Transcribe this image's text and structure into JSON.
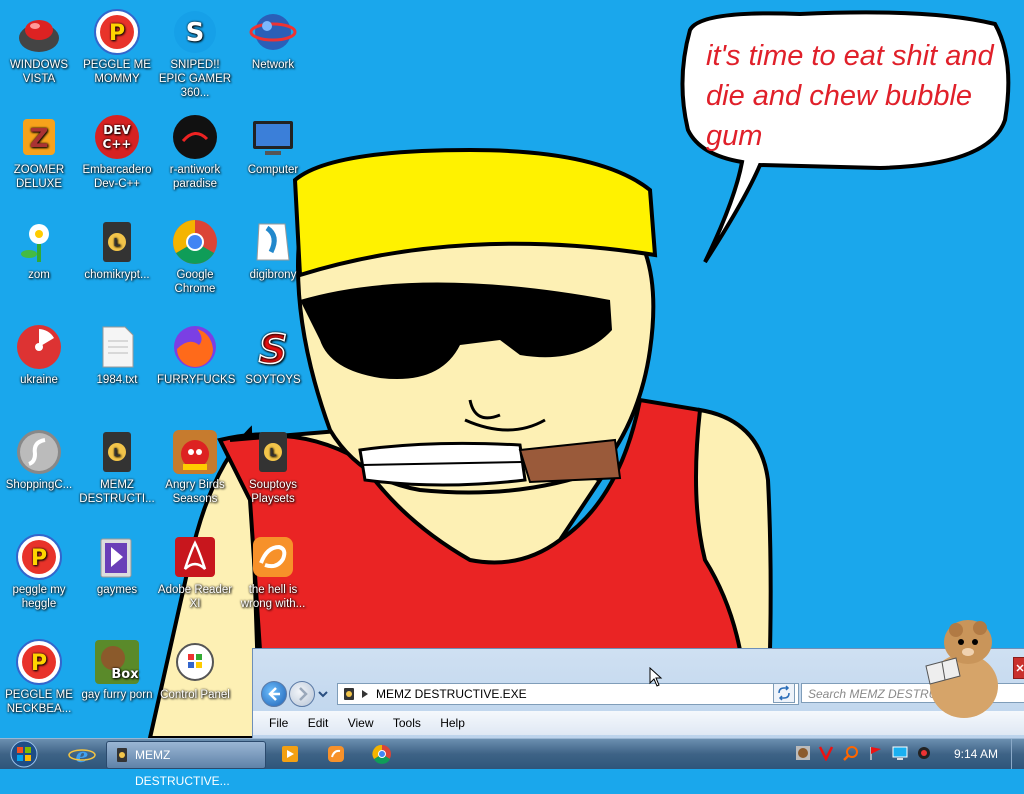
{
  "desktop": {
    "icons": [
      {
        "label": "WINDOWS VISTA"
      },
      {
        "label": "PEGGLE ME MOMMY"
      },
      {
        "label": "SNIPED!! EPIC GAMER 360..."
      },
      {
        "label": "Network"
      },
      {
        "label": "ZOOMER DELUXE"
      },
      {
        "label": "Embarcadero Dev-C++"
      },
      {
        "label": "r-antiwork paradise"
      },
      {
        "label": "Computer"
      },
      {
        "label": "zom"
      },
      {
        "label": "chomikrypt..."
      },
      {
        "label": "Google Chrome"
      },
      {
        "label": "digibrony"
      },
      {
        "label": "ukraine"
      },
      {
        "label": "1984.txt"
      },
      {
        "label": "FURRYFUCKS"
      },
      {
        "label": "SOYTOYS"
      },
      {
        "label": "ShoppingC..."
      },
      {
        "label": "MEMZ DESTRUCTI..."
      },
      {
        "label": "Angry Birds Seasons"
      },
      {
        "label": "Souptoys Playsets"
      },
      {
        "label": "peggle my heggle"
      },
      {
        "label": "gaymes"
      },
      {
        "label": "Adobe Reader XI"
      },
      {
        "label": "the hell is wrong with..."
      },
      {
        "label": "PEGGLE ME NECKBEA..."
      },
      {
        "label": "gay furry porn"
      },
      {
        "label": "Control Panel"
      }
    ],
    "speech_bubble": "it's time to eat shit and die and chew bubble gum"
  },
  "explorer": {
    "address": "MEMZ DESTRUCTIVE.EXE",
    "search_placeholder": "Search MEMZ DESTRUCTI...",
    "menu": [
      "File",
      "Edit",
      "View",
      "Tools",
      "Help"
    ]
  },
  "taskbar": {
    "active_window": "MEMZ DESTRUCTIVE...",
    "clock": "9:14 AM"
  },
  "colors": {
    "desktop_bg": "#1aa7ec",
    "bubble_text": "#e0202a",
    "taskbar": "#3e6386"
  }
}
